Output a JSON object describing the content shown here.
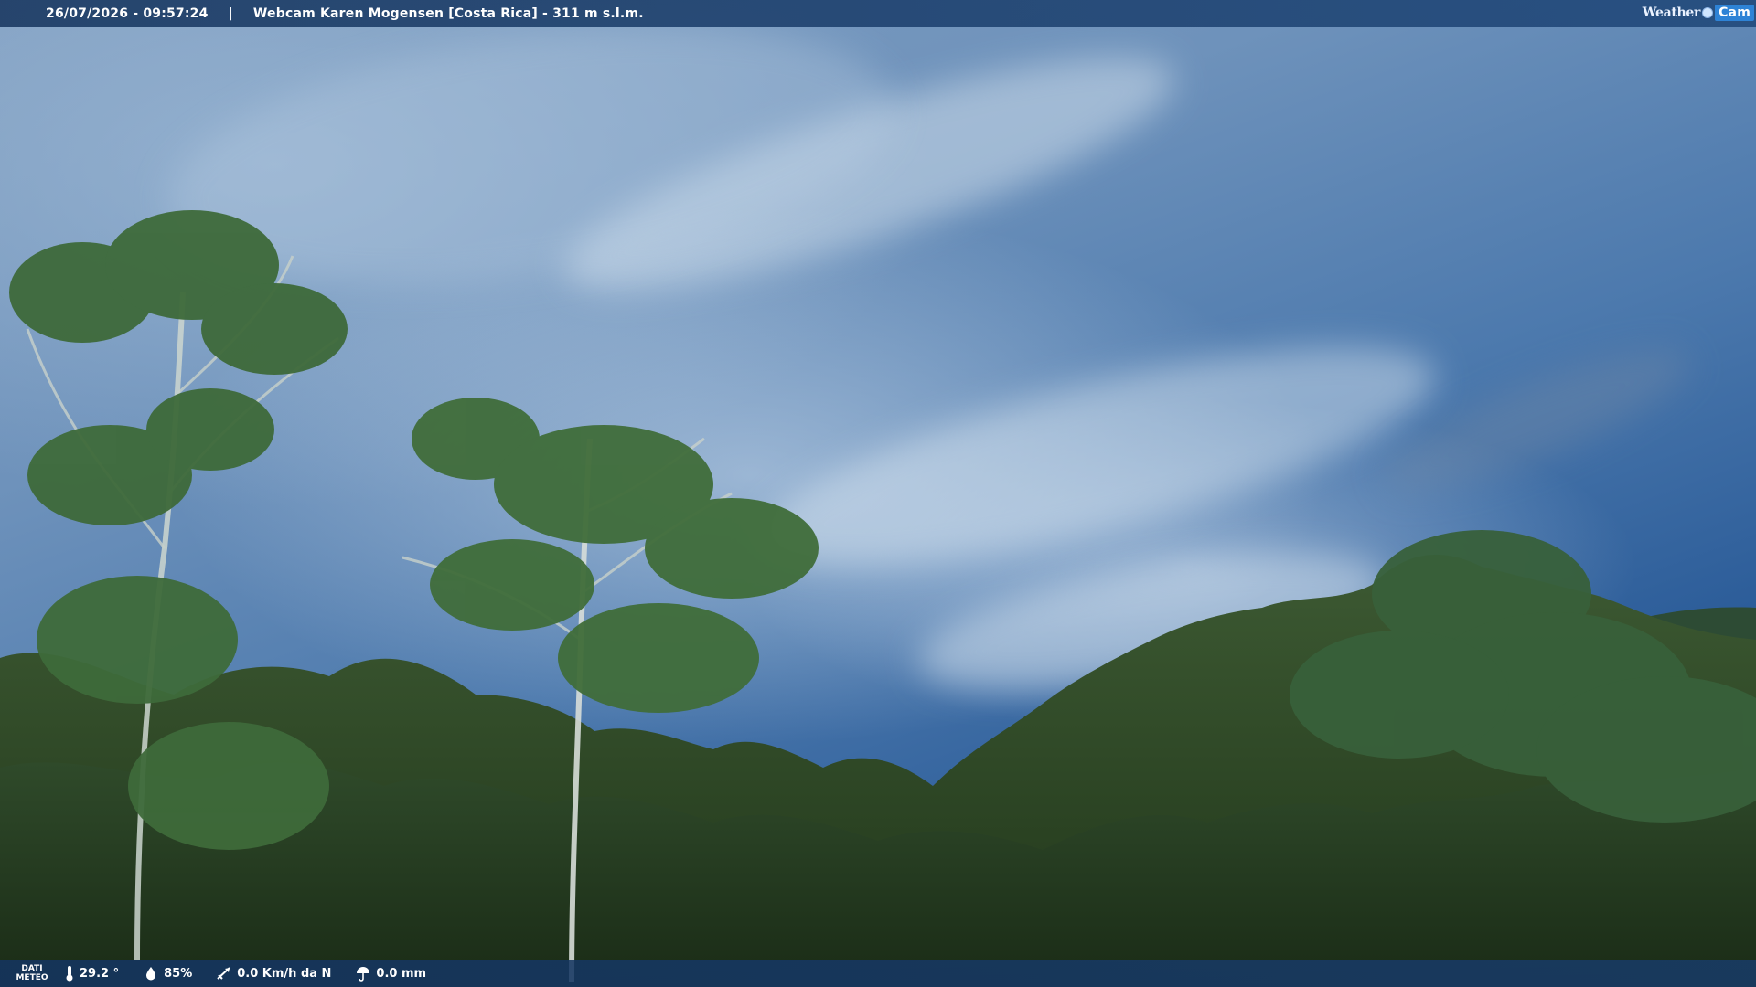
{
  "header": {
    "datetime": "26/07/2026 - 09:57:24",
    "separator": "|",
    "title": "Webcam Karen Mogensen [Costa Rica]  - 311 m s.l.m."
  },
  "brand": {
    "part1": "Weather",
    "part2": "Cam"
  },
  "weather": {
    "label_line1": "DATI",
    "label_line2": "METEO",
    "temperature": "29.2 °",
    "humidity": "85%",
    "wind": "0.0 Km/h da N",
    "rain": "0.0 mm"
  },
  "colors": {
    "bar_bg": "#1b3d6a",
    "brand_accent": "#2e83d6"
  }
}
